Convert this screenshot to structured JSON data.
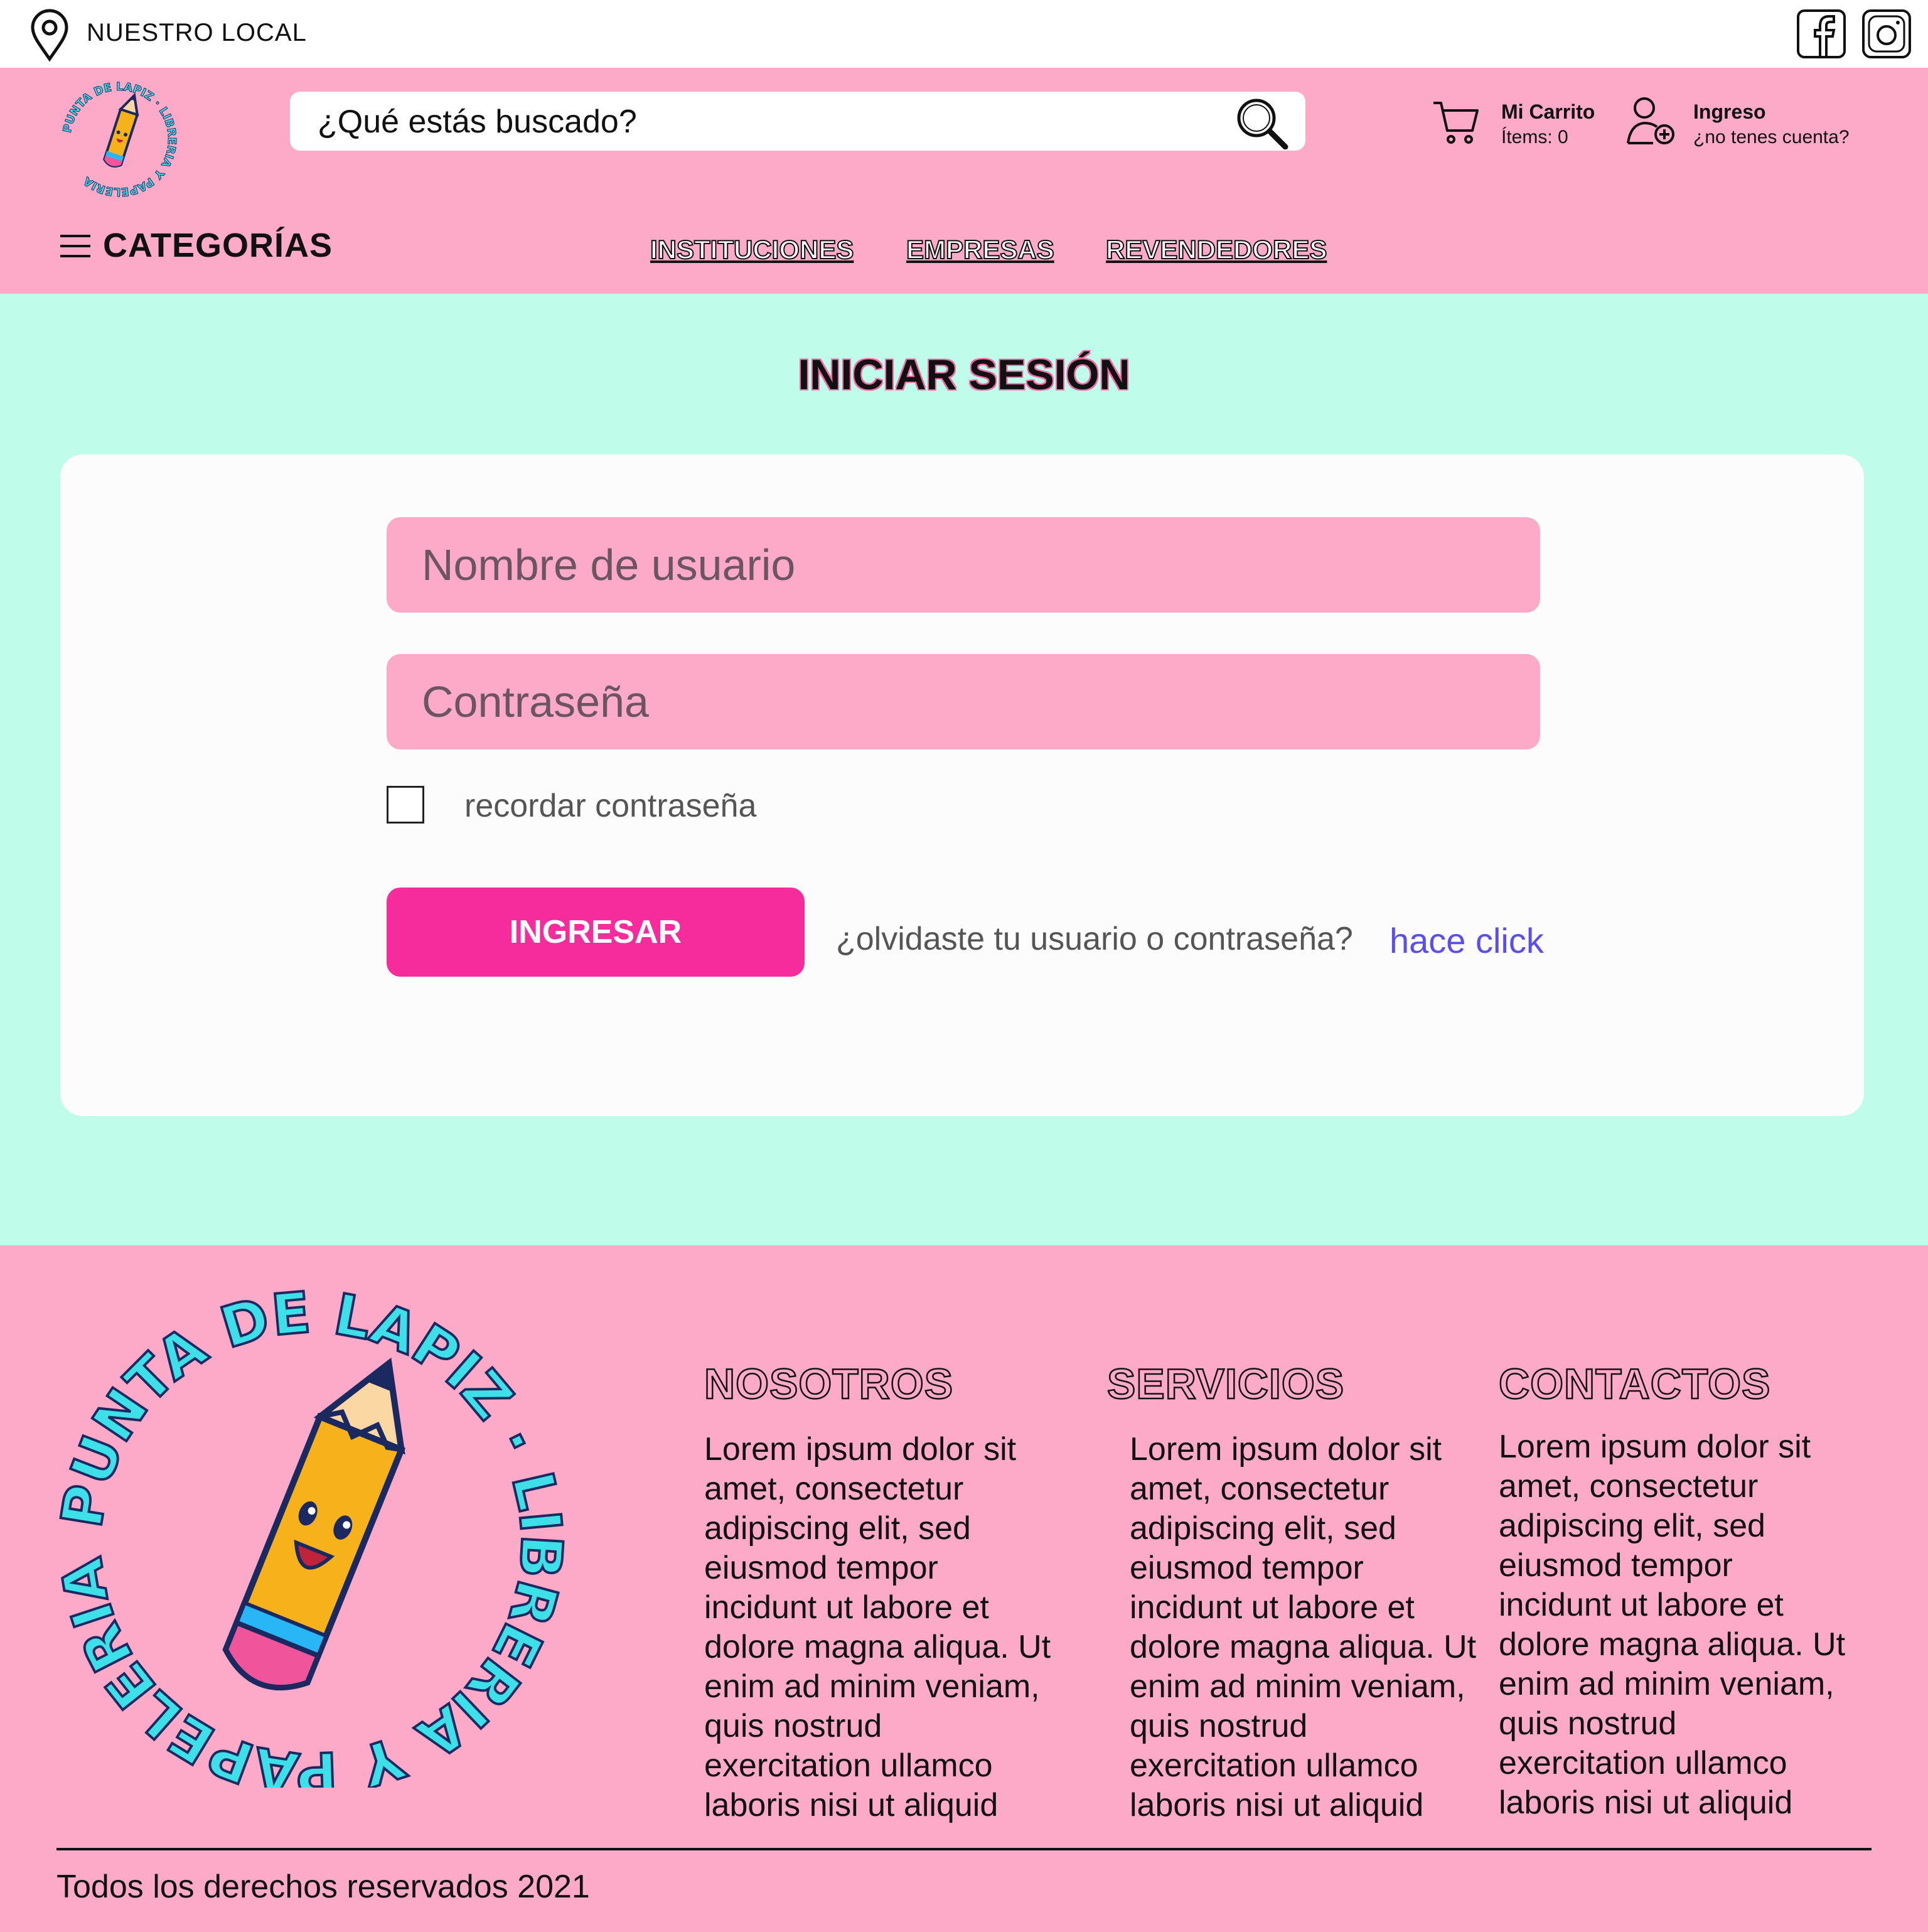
{
  "topbar": {
    "location_label": "NUESTRO LOCAL",
    "social": [
      "facebook-icon",
      "instagram-icon"
    ]
  },
  "header": {
    "logo_text_top": "PUNTA DE LAPIZ",
    "logo_text_bottom": "LIBRERIA Y PAPELERIA",
    "search_placeholder": "¿Qué estás buscado?",
    "cart": {
      "title": "Mi Carrito",
      "items": "Ítems: 0"
    },
    "login": {
      "title": "Ingreso",
      "subtitle": "¿no tenes cuenta?"
    },
    "categories_label": "CATEGORÍAS",
    "nav": [
      "INSTITUCIONES",
      "EMPRESAS",
      "REVENDEDORES"
    ]
  },
  "main": {
    "title": "INICIAR SESIÓN",
    "username_placeholder": "Nombre de usuario",
    "password_placeholder": "Contraseña",
    "remember_label": "recordar contraseña",
    "submit_label": "INGRESAR",
    "forgot_text": "¿olvidaste tu usuario o contraseña?",
    "forgot_link": "hace click"
  },
  "footer": {
    "columns": [
      {
        "title": "NOSOTROS",
        "text": "Lorem ipsum dolor sit amet, consectetur adipiscing elit, sed eiusmod tempor incidunt ut labore et dolore magna aliqua. Ut enim ad minim veniam, quis nostrud exercitation ullamco laboris nisi ut aliquid"
      },
      {
        "title": "SERVICIOS",
        "text": "Lorem ipsum dolor sit amet, consectetur adipiscing elit, sed eiusmod tempor incidunt ut labore et dolore magna aliqua. Ut enim ad minim veniam, quis nostrud exercitation ullamco laboris nisi ut aliquid"
      },
      {
        "title": "CONTACTOS",
        "text": "Lorem ipsum dolor sit amet, consectetur adipiscing elit, sed eiusmod tempor incidunt ut labore et dolore magna aliqua. Ut enim ad minim veniam, quis nostrud exercitation ullamco laboris nisi ut aliquid"
      }
    ],
    "copyright": "Todos los derechos reservados 2021"
  },
  "colors": {
    "pink": "#fdaac9",
    "mint": "#c0fcea",
    "button": "#f72c9c",
    "link": "#5a4ef0",
    "logo_text": "#3de0e8"
  }
}
